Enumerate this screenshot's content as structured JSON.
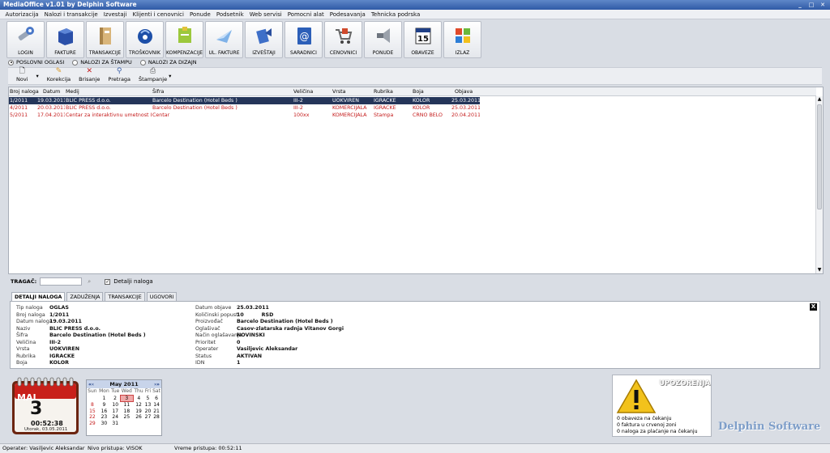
{
  "window": {
    "title": "MediaOffice v1.01 by Delphin Software",
    "buttons": [
      "_",
      "□",
      "✕"
    ]
  },
  "menu": [
    "Autorizacija",
    "Nalozi i transakcije",
    "Izvestaji",
    "Klijenti i cenovnici",
    "Ponude",
    "Podsetnik",
    "Web servisi",
    "Pomocni alat",
    "Podesavanja",
    "Tehnicka podrska"
  ],
  "toolbar": [
    {
      "label": "LOGIN",
      "icon": "key-icon"
    },
    {
      "label": "FAKTURE",
      "icon": "invoice-box-icon"
    },
    {
      "label": "TRANSAKCIJE",
      "icon": "binder-icon"
    },
    {
      "label": "TROŠKOVNIK",
      "icon": "cost-icon"
    },
    {
      "label": "KOMPENZACIJE",
      "icon": "note-icon"
    },
    {
      "label": "UL. FAKTURE",
      "icon": "incoming-invoice-icon"
    },
    {
      "label": "IZVEŠTAJI",
      "icon": "report-icon"
    },
    {
      "label": "SARADNICI",
      "icon": "address-book-icon"
    },
    {
      "label": "CENOVNICI",
      "icon": "cart-icon"
    },
    {
      "label": "PONUDE",
      "icon": "megaphone-icon"
    },
    {
      "label": "OBAVEZE",
      "icon": "calendar-icon"
    },
    {
      "label": "IZLAZ",
      "icon": "windows-icon"
    }
  ],
  "radio_options": [
    {
      "label": "POSLOVNI OGLASI",
      "selected": true
    },
    {
      "label": "NALOZI ZA ŠTAMPU",
      "selected": false
    },
    {
      "label": "NALOZI ZA DIZAJN",
      "selected": false
    }
  ],
  "subtoolbar": [
    {
      "label": "Novi",
      "icon": "new-doc-icon"
    },
    {
      "label": "Korekcija",
      "icon": "pencil-icon"
    },
    {
      "label": "Brisanje",
      "icon": "delete-x-icon"
    },
    {
      "label": "Pretraga",
      "icon": "binoculars-icon"
    },
    {
      "label": "Štampanje",
      "icon": "printer-icon"
    }
  ],
  "table": {
    "columns": [
      "Broj naloga",
      "Datum",
      "Medij",
      "Šifra",
      "Veličina",
      "Vrsta",
      "Rubrika",
      "Boja",
      "Objava"
    ],
    "rows": [
      [
        "1/2011",
        "19.03.2011",
        "BLIC PRESS d.o.o.",
        "Barcelo Destination (Hotel Beds )",
        "III-2",
        "UOKVIREN",
        "IGRACKE",
        "KOLOR",
        "25.03.2011"
      ],
      [
        "4/2011",
        "20.03.2011",
        "BLIC PRESS d.o.o.",
        "Barcelo Destination (Hotel Beds )",
        "III-2",
        "KOMERCIJALA",
        "IGRACKE",
        "KOLOR",
        "25.03.2011"
      ],
      [
        "5/2011",
        "17.04.2011",
        "Centar za interaktivnu umetnost INSTAGE",
        "Centar",
        "100xx",
        "KOMERCIJALA",
        "Stampa",
        "CRNO BELO",
        "20.04.2011"
      ]
    ]
  },
  "tracker": {
    "label": "TRAGAČ:",
    "value": "",
    "details_label": "Detalji naloga",
    "details_checked": true
  },
  "detail_tabs": [
    "DETALJI NALOGA",
    "ZADUŽENJA",
    "TRANSAKCIJE",
    "UGOVORI"
  ],
  "details_left": [
    [
      "Tip naloga",
      "OGLAS"
    ],
    [
      "Broj naloga",
      "1/2011"
    ],
    [
      "Datum naloga",
      "19.03.2011"
    ],
    [
      "Naziv",
      "BLIC PRESS d.o.o."
    ],
    [
      "Šifra",
      "Barcelo Destination (Hotel Beds )"
    ],
    [
      "Veličina",
      "III-2"
    ],
    [
      "Vrsta",
      "UOKVIREN"
    ],
    [
      "Rubrika",
      "IGRACKE"
    ],
    [
      "Boja",
      "KOLOR"
    ]
  ],
  "details_right": [
    [
      "Datum objave",
      "25.03.2011"
    ],
    [
      "Količinski popust",
      "10          RSD"
    ],
    [
      "Proizvođač",
      "Barcelo Destination (Hotel Beds )"
    ],
    [
      "Oglašivač",
      "Casov-zlatarska radnja Vitanov Gorgi"
    ],
    [
      "Način oglašavanja",
      "NOVINSKI"
    ],
    [
      "Prioritet",
      "0"
    ],
    [
      "Operater",
      "Vasiljevic Aleksandar"
    ],
    [
      "Status",
      "AKTIVAN"
    ],
    [
      "IDN",
      "1"
    ]
  ],
  "clock": {
    "month": "MAJ",
    "day": "3",
    "time": "00:52:38",
    "date_line": "Utorak, 03.05.2011"
  },
  "calendar": {
    "title": "May 2011",
    "weekdays": [
      "Sun",
      "Mon",
      "Tue",
      "Wed",
      "Thu",
      "Fri",
      "Sat"
    ],
    "weeks": [
      [
        "",
        "2",
        "3",
        "4",
        "5",
        "6",
        "7"
      ],
      [
        "8",
        "9",
        "10",
        "11",
        "12",
        "13",
        "14"
      ],
      [
        "15",
        "16",
        "17",
        "18",
        "19",
        "20",
        "21"
      ],
      [
        "22",
        "23",
        "24",
        "25",
        "26",
        "27",
        "28"
      ],
      [
        "29",
        "30",
        "31",
        "",
        "",
        "",
        ""
      ]
    ],
    "first_day": "1",
    "today": "3"
  },
  "warnings": {
    "title": "UPOZORENJA",
    "lines": [
      "0 obaveza na čekanju",
      "0 faktura u crvenoj zoni",
      "0 naloga za plaćanje na čekanju"
    ]
  },
  "brand": "Delphin Software",
  "status": {
    "operator": "Operater: Vasiljevic Aleksandar",
    "level": "Nivo pristupa: VISOK",
    "access_time": "Vreme pristupa: 00:52:11"
  },
  "colors": {
    "selected_row": "#243559",
    "red_row": "#c41a1a",
    "title_bar": "#2f5aa6"
  }
}
